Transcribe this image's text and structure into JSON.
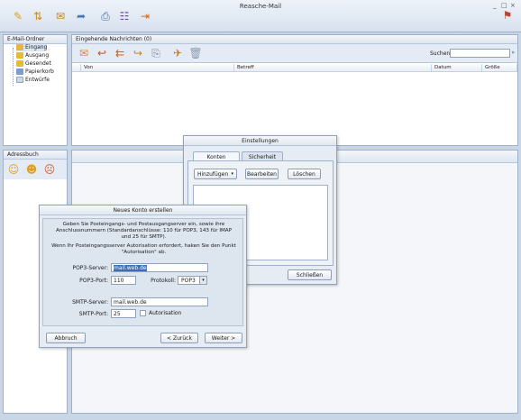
{
  "window": {
    "title": "Reasche-Mail",
    "controls": [
      "_",
      "□",
      "×"
    ]
  },
  "toolbar": {
    "icons": [
      "compose-icon",
      "send-receive-icon",
      "reply-icon",
      "forward-icon",
      "print-icon",
      "address-book-icon",
      "exit-icon",
      "flag-icon"
    ]
  },
  "folders": {
    "header": "E-Mail-Ordner",
    "items": [
      {
        "label": "Eingang",
        "selected": true
      },
      {
        "label": "Ausgang"
      },
      {
        "label": "Gesendet"
      },
      {
        "label": "Papierkorb"
      },
      {
        "label": "Entwürfe"
      }
    ]
  },
  "addressbook": {
    "header": "Adressbuch"
  },
  "inbox": {
    "header": "Eingehende Nachrichten (0)",
    "search_label": "Suchen:",
    "search_value": "",
    "columns": [
      "Von",
      "Betreff",
      "Datum",
      "Größe"
    ]
  },
  "settings_dialog": {
    "title": "Einstellungen",
    "tabs": [
      "Konten",
      "Sicherheit"
    ],
    "add_label": "Hinzufügen",
    "edit_label": "Bearbeiten",
    "delete_label": "Löschen",
    "close_label": "Schließen"
  },
  "account_dialog": {
    "title": "Neues Konto erstellen",
    "info_1": "Geben Sie Posteingangs- und Postausgangserver ein, sowie ihre Anschlussnummern (Standardanschlüsse: 110 für POP3, 143 für IMAP und 25 für SMTP).",
    "info_2": "Wenn Ihr Posteingangsserver Autorisation erfordert, haken Sie den Punkt \"Autorisation\" ab.",
    "pop3_server_label": "POP3-Server:",
    "pop3_server_value": "mail.web.de",
    "pop3_port_label": "POP3-Port:",
    "pop3_port_value": "110",
    "protocol_label": "Protokoll:",
    "protocol_value": "POP3",
    "smtp_server_label": "SMTP-Server:",
    "smtp_server_value": "mail.web.de",
    "smtp_port_label": "SMTP-Port:",
    "smtp_port_value": "25",
    "auth_label": "Autorisation",
    "cancel_label": "Abbruch",
    "back_label": "< Zurück",
    "next_label": "Weiter >"
  }
}
